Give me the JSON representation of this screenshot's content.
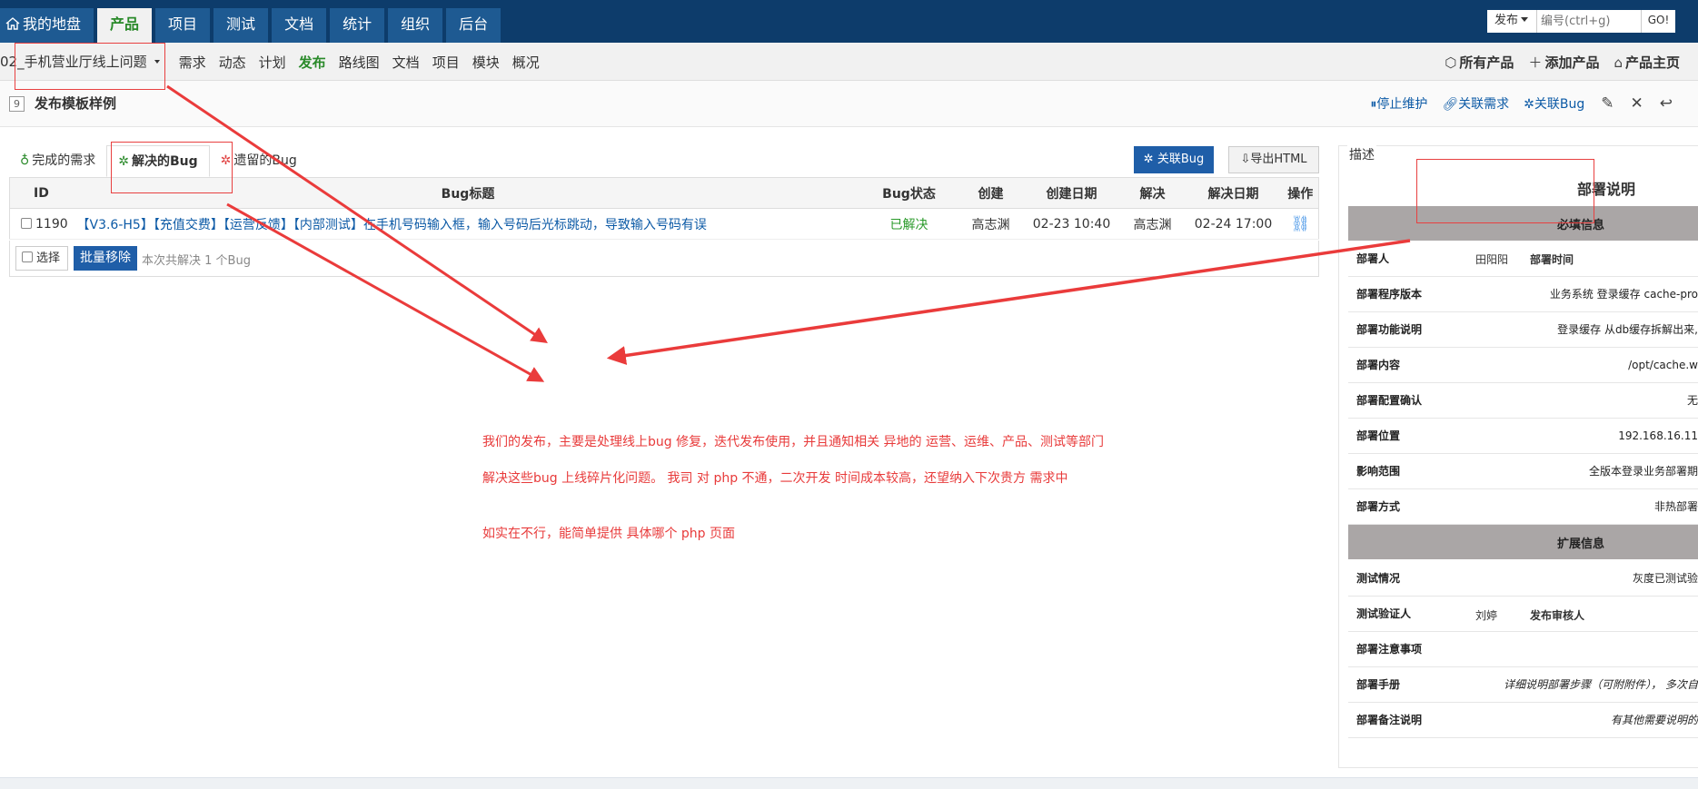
{
  "topnav": {
    "tabs": [
      "我的地盘",
      "产品",
      "项目",
      "测试",
      "文档",
      "统计",
      "组织",
      "后台"
    ],
    "active": "产品"
  },
  "quick": {
    "type_label": "发布",
    "placeholder": "编号(ctrl+g)",
    "go_label": "GO!"
  },
  "subnav": {
    "product": "02_手机营业厅线上问题",
    "items": [
      "需求",
      "动态",
      "计划",
      "发布",
      "路线图",
      "文档",
      "项目",
      "模块",
      "概况"
    ],
    "active": "发布",
    "right": [
      "所有产品",
      "添加产品",
      "产品主页"
    ]
  },
  "page": {
    "id": "9",
    "title": "发布模板样例",
    "actions": [
      "停止维护",
      "关联需求",
      "关联Bug"
    ]
  },
  "tabs": [
    "完成的需求",
    "解决的Bug",
    "遗留的Bug"
  ],
  "buttons": {
    "link_bug": "关联Bug",
    "export": "导出HTML",
    "select": "选择",
    "batch_remove": "批量移除"
  },
  "table": {
    "headers": [
      "ID",
      "Bug标题",
      "Bug状态",
      "创建",
      "创建日期",
      "解决",
      "解决日期",
      "操作"
    ],
    "rows": [
      {
        "id": "1190",
        "title": "【V3.6-H5】【充值交费】【运营反馈】【内部测试】在手机号码输入框，输入号码后光标跳动，导致输入号码有误",
        "status": "已解决",
        "created_by": "高志渊",
        "created_date": "02-23 10:40",
        "resolved_by": "高志渊",
        "resolved_date": "02-24 17:00"
      }
    ],
    "footer_note": "本次共解决 1 个Bug"
  },
  "notes": [
    "我们的发布，主要是处理线上bug 修复，迭代发布使用，并且通知相关  异地的 运营、运维、产品、测试等部门",
    "解决这些bug 上线碎片化问题。 我司 对 php 不通，二次开发  时间成本较高，还望纳入下次贵方 需求中",
    "如实在不行，能简单提供 具体哪个 php 页面"
  ],
  "desc": {
    "label": "描述",
    "heading": "部署说明",
    "section1": "必填信息",
    "section2": "扩展信息",
    "deployer_key": "部署人",
    "deployer_val": "田阳阳",
    "deploy_time_key": "部署时间",
    "tester_key": "测试验证人",
    "tester_val": "刘婷",
    "reviewer_key": "发布审核人",
    "rows1": [
      {
        "k": "部署程序版本",
        "v": "业务系统 登录缓存 cache-pro"
      },
      {
        "k": "部署功能说明",
        "v": "登录缓存 从db缓存拆解出来,"
      },
      {
        "k": "部署内容",
        "v": "/opt/cache.w"
      },
      {
        "k": "部署配置确认",
        "v": "无"
      },
      {
        "k": "部署位置",
        "v": "192.168.16.11"
      },
      {
        "k": "影响范围",
        "v": "全版本登录业务部署期"
      },
      {
        "k": "部署方式",
        "v": "非热部署"
      }
    ],
    "test_key": "测试情况",
    "test_val": "灰度已测试验",
    "rows2": [
      {
        "k": "部署注意事项",
        "v": ""
      },
      {
        "k": "部署手册",
        "v": "详细说明部署步骤（可附附件）， 多次自"
      },
      {
        "k": "部署备注说明",
        "v": "有其他需要说明的"
      }
    ]
  },
  "colors": {
    "topbar": "#0d3c6b",
    "tab": "#1e5a92",
    "active_green": "#2a8a2a",
    "primary_btn": "#1f5ea8",
    "annotation_red": "#e83a3a",
    "link_blue": "#0c5aa6"
  }
}
